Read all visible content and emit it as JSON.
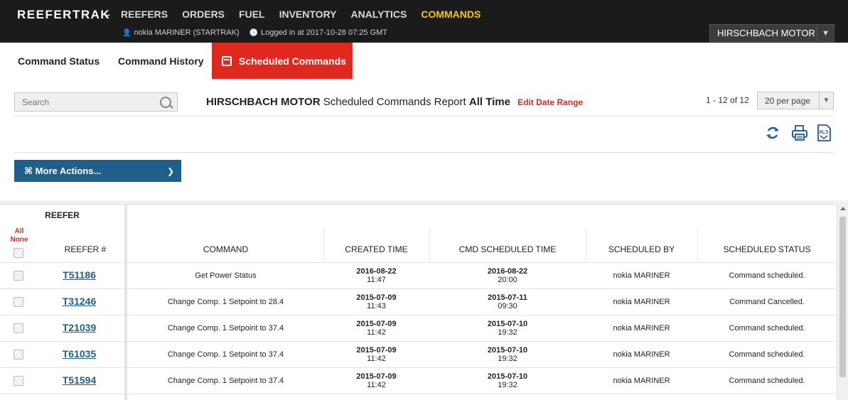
{
  "app": {
    "brand": "REEFERTRAK",
    "nav": [
      "REEFERS",
      "ORDERS",
      "FUEL",
      "INVENTORY",
      "ANALYTICS",
      "COMMANDS"
    ],
    "active_nav": "COMMANDS",
    "user": "nokia MARINER (STARTRAK)",
    "login": "Logged in at 2017-10-28 07:25 GMT",
    "company": "HIRSCHBACH MOTOR"
  },
  "tabs": {
    "status": "Command Status",
    "history": "Command History",
    "scheduled": "Scheduled Commands"
  },
  "toolbar": {
    "search_placeholder": "Search",
    "report_company": "HIRSCHBACH MOTOR",
    "report_name": "Scheduled Commands Report",
    "report_range": "All Time",
    "edit_range": "Edit Date Range",
    "paging": "1 - 12 of 12",
    "per_page": "20 per page",
    "more_actions": "⌘ More Actions..."
  },
  "colors": {
    "accent": "#e0281f",
    "primary": "#1e5f8c",
    "nav_active": "#f5c518"
  },
  "grid": {
    "group_header": "REEFER",
    "all": "All",
    "none": "None",
    "headers": {
      "reefer": "REEFER #",
      "command": "COMMAND",
      "created": "CREATED TIME",
      "scheduled": "CMD SCHEDULED TIME",
      "by": "SCHEDULED BY",
      "status": "SCHEDULED STATUS"
    },
    "rows": [
      {
        "reefer": "T51186",
        "command": "Get Power Status",
        "created_date": "2016-08-22",
        "created_time": "11:47",
        "sched_date": "2016-08-22",
        "sched_time": "20:00",
        "by": "nokia MARINER",
        "status": "Command scheduled."
      },
      {
        "reefer": "T31246",
        "command": "Change Comp. 1 Setpoint to 28.4",
        "created_date": "2015-07-09",
        "created_time": "11:43",
        "sched_date": "2015-07-11",
        "sched_time": "09:30",
        "by": "nokia MARINER",
        "status": "Command Cancelled."
      },
      {
        "reefer": "T21039",
        "command": "Change Comp. 1 Setpoint to 37.4",
        "created_date": "2015-07-09",
        "created_time": "11:42",
        "sched_date": "2015-07-10",
        "sched_time": "19:32",
        "by": "nokia MARINER",
        "status": "Command scheduled."
      },
      {
        "reefer": "T61035",
        "command": "Change Comp. 1 Setpoint to 37.4",
        "created_date": "2015-07-09",
        "created_time": "11:42",
        "sched_date": "2015-07-10",
        "sched_time": "19:32",
        "by": "nokia MARINER",
        "status": "Command scheduled."
      },
      {
        "reefer": "T51594",
        "command": "Change Comp. 1 Setpoint to 37.4",
        "created_date": "2015-07-09",
        "created_time": "11:42",
        "sched_date": "2015-07-10",
        "sched_time": "19:32",
        "by": "nokia MARINER",
        "status": "Command scheduled."
      }
    ]
  }
}
